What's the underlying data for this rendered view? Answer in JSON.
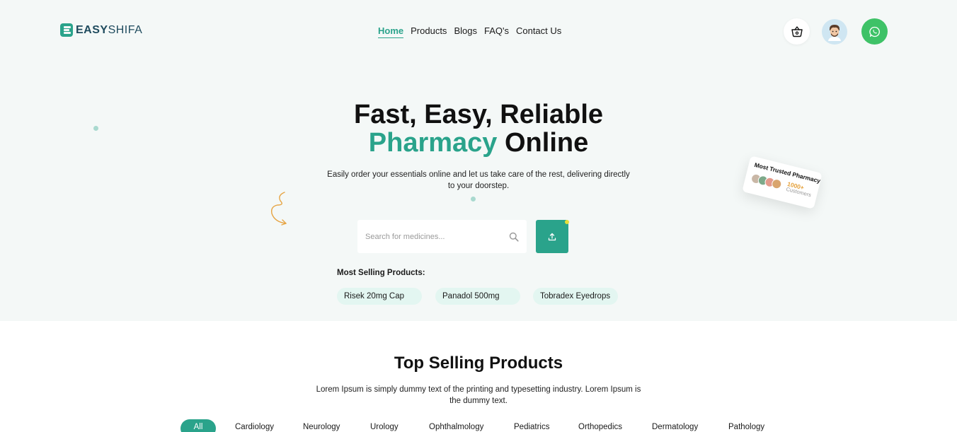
{
  "logo": {
    "easy": "EASY",
    "shifa": "SHIFA"
  },
  "nav": {
    "items": [
      {
        "label": "Home",
        "active": true
      },
      {
        "label": "Products",
        "active": false
      },
      {
        "label": "Blogs",
        "active": false
      },
      {
        "label": "FAQ's",
        "active": false
      },
      {
        "label": "Contact Us",
        "active": false
      }
    ]
  },
  "header_icons": {
    "cart": "basket-icon",
    "avatar": "user-avatar",
    "whatsapp": "whatsapp-icon"
  },
  "hero": {
    "title_line1": "Fast, Easy, Reliable",
    "title_accent": "Pharmacy",
    "title_rest": " Online",
    "subtitle": "Easily order your essentials online and let us take care of the rest, delivering directly to your doorstep.",
    "search_placeholder": "Search for medicines...",
    "most_selling_label": "Most Selling Products:",
    "chips": [
      "Risek 20mg Cap",
      "Panadol 500mg",
      "Tobradex Eyedrops"
    ]
  },
  "trusted_card": {
    "title": "Most Trusted Pharmacy",
    "count": "1000+",
    "label": "Customers"
  },
  "top_selling": {
    "title": "Top Selling Products",
    "subtitle": "Lorem Ipsum is simply dummy text of the printing and typesetting industry. Lorem Ipsum is the dummy text.",
    "categories": [
      {
        "label": "All",
        "active": true
      },
      {
        "label": "Cardiology",
        "active": false
      },
      {
        "label": "Neurology",
        "active": false
      },
      {
        "label": "Urology",
        "active": false
      },
      {
        "label": "Ophthalmology",
        "active": false
      },
      {
        "label": "Pediatrics",
        "active": false
      },
      {
        "label": "Orthopedics",
        "active": false
      },
      {
        "label": "Dermatology",
        "active": false
      },
      {
        "label": "Pathology",
        "active": false
      }
    ]
  },
  "colors": {
    "accent": "#2aa38b",
    "hero_bg": "#f4f8f7",
    "chip_bg": "#e3f6f1",
    "whatsapp": "#3ec267",
    "highlight": "#e5a13b"
  }
}
